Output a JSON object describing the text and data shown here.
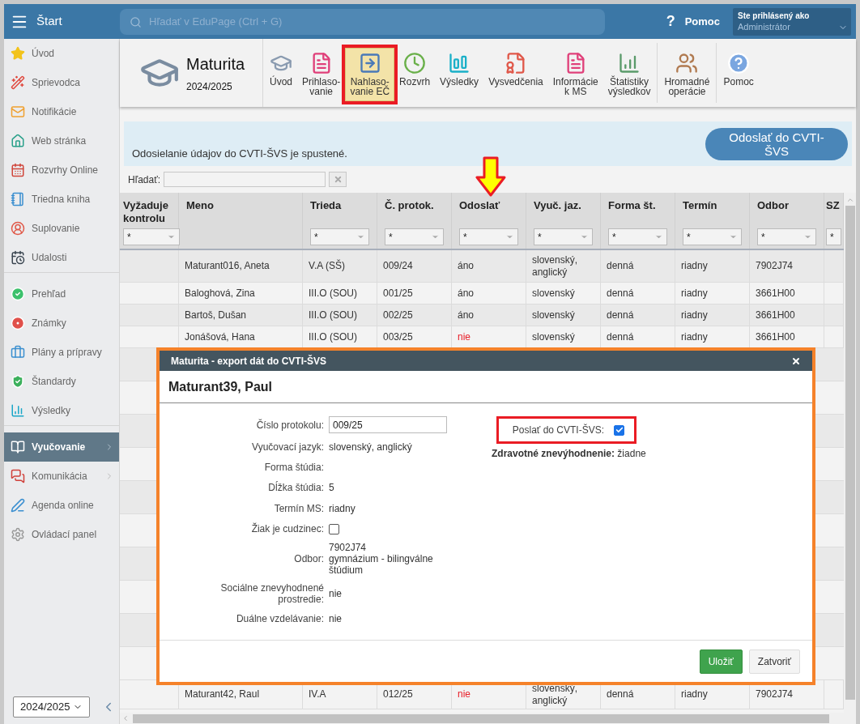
{
  "topbar": {
    "menu_label": "Štart",
    "search_placeholder": "Hľadať v EduPage (Ctrl + G)",
    "help_glyph": "?",
    "help_label": "Pomoc",
    "user": {
      "caption": "Ste prihlásený ako",
      "name": "Administrátor"
    }
  },
  "sidebar": {
    "groups": [
      [
        {
          "label": "Úvod",
          "selected": false,
          "has_submenu": false
        },
        {
          "label": "Sprievodca",
          "selected": false,
          "has_submenu": false
        },
        {
          "label": "Notifikácie",
          "selected": false,
          "has_submenu": false
        },
        {
          "label": "Web stránka",
          "selected": false,
          "has_submenu": false
        },
        {
          "label": "Rozvrhy Online",
          "selected": false,
          "has_submenu": false
        },
        {
          "label": "Triedna kniha",
          "selected": false,
          "has_submenu": false
        },
        {
          "label": "Suplovanie",
          "selected": false,
          "has_submenu": false
        },
        {
          "label": "Udalosti",
          "selected": false,
          "has_submenu": false
        }
      ],
      [
        {
          "label": "Prehľad",
          "selected": false,
          "has_submenu": false
        },
        {
          "label": "Známky",
          "selected": false,
          "has_submenu": false
        },
        {
          "label": "Plány a prípravy",
          "selected": false,
          "has_submenu": false
        },
        {
          "label": "Štandardy",
          "selected": false,
          "has_submenu": false
        },
        {
          "label": "Výsledky",
          "selected": false,
          "has_submenu": false
        }
      ],
      [
        {
          "label": "Vyučovanie",
          "selected": true,
          "has_submenu": true
        },
        {
          "label": "Komunikácia",
          "selected": false,
          "has_submenu": true
        },
        {
          "label": "Agenda online",
          "selected": false,
          "has_submenu": false
        },
        {
          "label": "Ovládací panel",
          "selected": false,
          "has_submenu": false
        }
      ]
    ],
    "year": "2024/2025"
  },
  "toolbar": {
    "title": "Maturita",
    "year": "2024/2025",
    "groups": [
      [
        {
          "label": "Úvod",
          "selected": false,
          "highlighted": false
        },
        {
          "label": "Prihlaso-\nvanie",
          "selected": false,
          "highlighted": false
        },
        {
          "label": "Nahlaso-\nvanie EČ",
          "selected": true,
          "highlighted": true
        },
        {
          "label": "Rozvrh",
          "selected": false,
          "highlighted": false
        },
        {
          "label": "Výsledky",
          "selected": false,
          "highlighted": false
        },
        {
          "label": "Vysvedčenia",
          "selected": false,
          "highlighted": false
        },
        {
          "label": "Informácie\nk MS",
          "selected": false,
          "highlighted": false
        },
        {
          "label": "Štatistiky\nvýsledkov",
          "selected": false,
          "highlighted": false
        }
      ],
      [
        {
          "label": "Hromadné\noperácie",
          "selected": false,
          "highlighted": false
        }
      ],
      [
        {
          "label": "Pomoc",
          "selected": false,
          "highlighted": false
        }
      ]
    ]
  },
  "banner": {
    "message": "Odosielanie údajov do CVTI-ŠVS je spustené.",
    "button": "Odoslať do CVTI-ŠVS"
  },
  "search": {
    "label": "Hľadať:"
  },
  "table": {
    "columns": [
      {
        "label": "Vyžaduje kontrolu",
        "filter": "*"
      },
      {
        "label": "Meno"
      },
      {
        "label": "Trieda",
        "filter": "*"
      },
      {
        "label": "Č. protok.",
        "filter": "*"
      },
      {
        "label": "Odoslať",
        "filter": "*"
      },
      {
        "label": "Vyuč. jaz.",
        "filter": "*"
      },
      {
        "label": "Forma št.",
        "filter": "*"
      },
      {
        "label": "Termín",
        "filter": "*"
      },
      {
        "label": "Odbor",
        "filter": "*"
      },
      {
        "label": "SZ",
        "filter": "*"
      }
    ],
    "rows": [
      {
        "meno": "Maturant016, Aneta",
        "trieda": "V.A (SŠ)",
        "protokol": "009/24",
        "odoslat": "áno",
        "odoslat_ok": true,
        "jazyk": "slovenský, anglický",
        "forma": "denná",
        "termin": "riadny",
        "odbor": "7902J74"
      },
      {
        "meno": "Baloghová, Zina",
        "trieda": "III.O (SOU)",
        "protokol": "001/25",
        "odoslat": "áno",
        "odoslat_ok": true,
        "jazyk": "slovenský",
        "forma": "denná",
        "termin": "riadny",
        "odbor": "3661H00"
      },
      {
        "meno": "Bartoš, Dušan",
        "trieda": "III.O (SOU)",
        "protokol": "002/25",
        "odoslat": "áno",
        "odoslat_ok": true,
        "jazyk": "slovenský",
        "forma": "denná",
        "termin": "riadny",
        "odbor": "3661H00"
      },
      {
        "meno": "Jonášová, Hana",
        "trieda": "III.O (SOU)",
        "protokol": "003/25",
        "odoslat": "nie",
        "odoslat_ok": false,
        "jazyk": "slovenský",
        "forma": "denná",
        "termin": "riadny",
        "odbor": "3661H00"
      }
    ],
    "last_row": {
      "meno": "Maturant42, Raul",
      "trieda": "IV.A",
      "protokol": "012/25",
      "odoslat": "nie",
      "odoslat_ok": false,
      "jazyk": "slovenský, anglický",
      "forma": "denná",
      "termin": "riadny",
      "odbor": "7902J74"
    }
  },
  "dialog": {
    "title": "Maturita - export dát do CVTI-ŠVS",
    "student": "Maturant39, Paul",
    "fields": [
      {
        "kind": "input",
        "label": "Číslo protokolu:",
        "value": "009/25"
      },
      {
        "kind": "text",
        "label": "Vyučovací jazyk:",
        "value": "slovenský, anglický"
      },
      {
        "kind": "text",
        "label": "Forma štúdia:"
      },
      {
        "kind": "text",
        "label": "Dĺžka štúdia:",
        "value": "5"
      },
      {
        "kind": "text",
        "label": "Termín MS:",
        "value": "riadny"
      },
      {
        "kind": "checkbox",
        "label": "Žiak je cudzinec:",
        "checked": false
      },
      {
        "kind": "lines",
        "label": "Odbor:",
        "lines": [
          "7902J74",
          "gymnázium - bilingválne štúdium"
        ]
      },
      {
        "kind": "text",
        "label": "Sociálne znevyhodnené prostredie:",
        "value": "nie"
      },
      {
        "kind": "text",
        "label": "Duálne vzdelávanie:",
        "value": "nie"
      }
    ],
    "send": {
      "label": "Poslať do CVTI-ŠVS:",
      "checked": true
    },
    "health": "**Zdravotné znevýhodnenie:** žiadne",
    "buttons": [
      {
        "label": "Uložiť",
        "kind": "primary"
      },
      {
        "label": "Zatvoriť",
        "kind": "secondary"
      }
    ]
  }
}
